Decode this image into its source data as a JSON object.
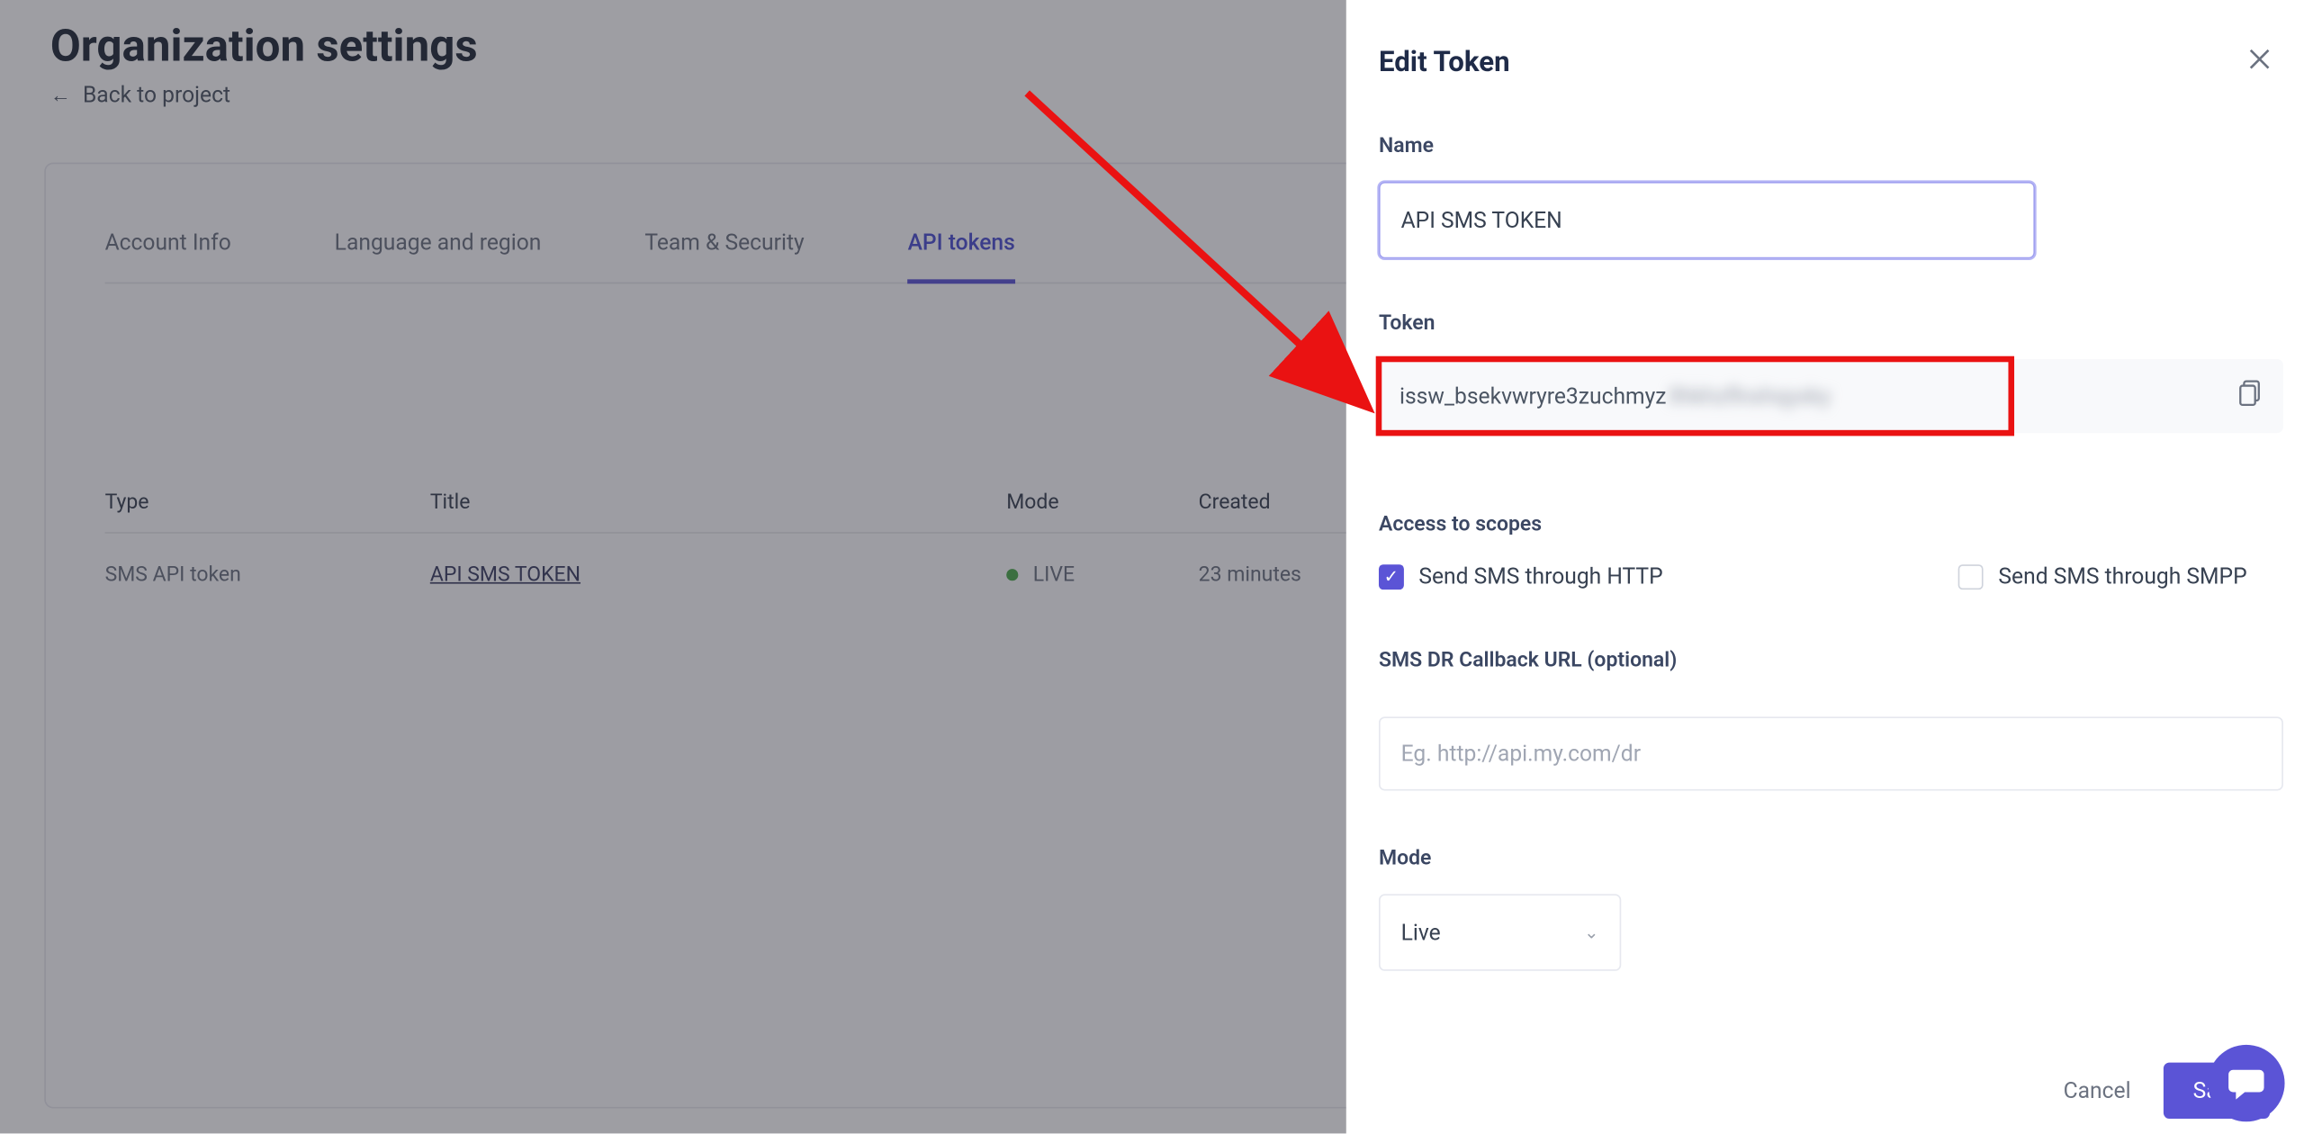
{
  "page": {
    "title": "Organization settings",
    "back_label": "Back to project"
  },
  "tabs": {
    "account": "Account Info",
    "language": "Language and region",
    "team": "Team & Security",
    "api": "API tokens"
  },
  "table": {
    "headers": {
      "type": "Type",
      "title": "Title",
      "mode": "Mode",
      "created": "Created"
    },
    "row": {
      "type": "SMS API token",
      "title": "API SMS TOKEN",
      "mode": "LIVE",
      "created": "23 minutes"
    }
  },
  "panel": {
    "title": "Edit Token",
    "name_label": "Name",
    "name_value": "API SMS TOKEN",
    "token_label": "Token",
    "token_visible": "issw_bsekvwryre3zuchmyz",
    "token_hidden": "llhkhzflnxhqyxky",
    "scopes_label": "Access to scopes",
    "scope_http": "Send SMS through HTTP",
    "scope_smpp": "Send SMS through SMPP",
    "callback_label": "SMS DR Callback URL (optional)",
    "callback_placeholder": "Eg. http://api.my.com/dr",
    "mode_label": "Mode",
    "mode_value": "Live",
    "cancel": "Cancel",
    "save": "Save"
  }
}
